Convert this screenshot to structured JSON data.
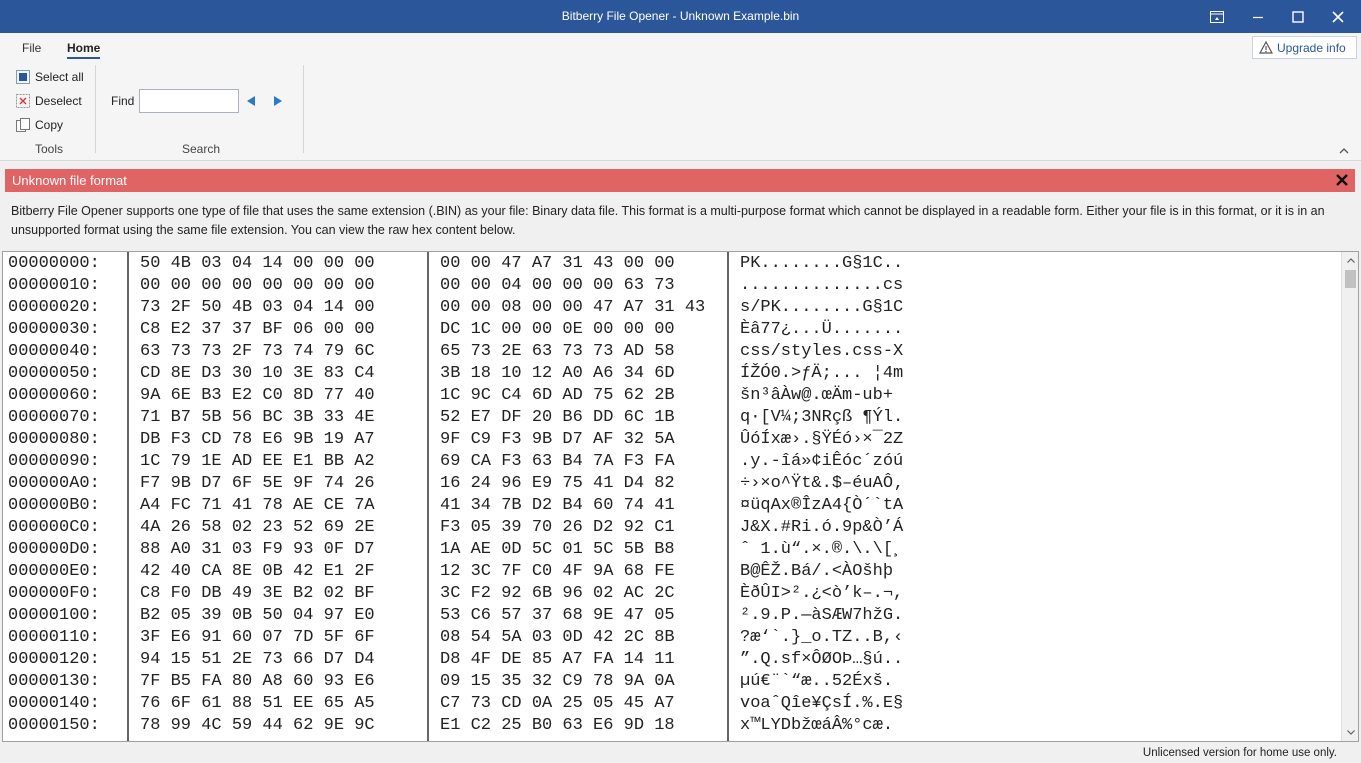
{
  "window": {
    "title": "Bitberry File Opener - Unknown Example.bin",
    "accent": "#2b579a"
  },
  "ribbon": {
    "tabs": [
      "File",
      "Home"
    ],
    "active_tab": "Home",
    "upgrade_label": "Upgrade info",
    "tools": {
      "select_all": "Select all",
      "deselect": "Deselect",
      "copy": "Copy",
      "group_label": "Tools"
    },
    "search": {
      "find_label": "Find",
      "find_value": "",
      "group_label": "Search"
    }
  },
  "alert": {
    "title": "Unknown file format",
    "color": "#e06464",
    "message": "Bitberry File Opener supports one type of file that uses the same extension (.BIN) as your file: Binary data file. This format is a multi-purpose format which cannot be displayed in a readable form. Either your file is in this format, or it is in an unsupported format using the same file extension. You can view the raw hex content below."
  },
  "hex": {
    "rows": [
      {
        "addr": "00000000:",
        "h1": "50 4B 03 04 14 00 00 00",
        "h2": "00 00 47 A7 31 43 00 00",
        "ascii": "PK........G§1C.."
      },
      {
        "addr": "00000010:",
        "h1": "00 00 00 00 00 00 00 00",
        "h2": "00 00 04 00 00 00 63 73",
        "ascii": "..............cs"
      },
      {
        "addr": "00000020:",
        "h1": "73 2F 50 4B 03 04 14 00",
        "h2": "00 00 08 00 00 47 A7 31 43",
        "ascii": "s/PK........G§1C"
      },
      {
        "addr": "00000030:",
        "h1": "C8 E2 37 37 BF 06 00 00",
        "h2": "DC 1C 00 00 0E 00 00 00",
        "ascii": "Èâ77¿...Ü......."
      },
      {
        "addr": "00000040:",
        "h1": "63 73 73 2F 73 74 79 6C",
        "h2": "65 73 2E 63 73 73 AD 58",
        "ascii": "css/styles.css-X"
      },
      {
        "addr": "00000050:",
        "h1": "CD 8E D3 30 10 3E 83 C4",
        "h2": "3B 18 10 12 A0 A6 34 6D",
        "ascii": "ÍŽÓ0.>ƒÄ;... ¦4m"
      },
      {
        "addr": "00000060:",
        "h1": "9A 6E B3 E2 C0 8D 77 40",
        "h2": "1C 9C C4 6D AD 75 62 2B",
        "ascii": "šn³âÀw@.œÄm-ub+"
      },
      {
        "addr": "00000070:",
        "h1": "71 B7 5B 56 BC 3B 33 4E",
        "h2": "52 E7 DF 20 B6 DD 6C 1B",
        "ascii": "q·[V¼;3NRçß ¶Ýl."
      },
      {
        "addr": "00000080:",
        "h1": "DB F3 CD 78 E6 9B 19 A7",
        "h2": "9F C9 F3 9B D7 AF 32 5A",
        "ascii": "ÛóÍxæ›.§ŸÉó›×¯2Z"
      },
      {
        "addr": "00000090:",
        "h1": "1C 79 1E AD EE E1 BB A2",
        "h2": "69 CA F3 63 B4 7A F3 FA",
        "ascii": ".y.-îá»¢iÊóc´zóú"
      },
      {
        "addr": "000000A0:",
        "h1": "F7 9B D7 6F 5E 9F 74 26",
        "h2": "16 24 96 E9 75 41 D4 82",
        "ascii": "÷›×o^Ÿt&.$–éuAÔ‚"
      },
      {
        "addr": "000000B0:",
        "h1": "A4 FC 71 41 78 AE CE 7A",
        "h2": "41 34 7B D2 B4 60 74 41",
        "ascii": "¤üqAx®ÎzA4{Ò´`tA"
      },
      {
        "addr": "000000C0:",
        "h1": "4A 26 58 02 23 52 69 2E",
        "h2": "F3 05 39 70 26 D2 92 C1",
        "ascii": "J&X.#Ri.ó.9p&Ò’Á"
      },
      {
        "addr": "000000D0:",
        "h1": "88 A0 31 03 F9 93 0F D7",
        "h2": "1A AE 0D 5C 01 5C 5B B8",
        "ascii": "ˆ 1.ù“.×.®.\\.\\[¸"
      },
      {
        "addr": "000000E0:",
        "h1": "42 40 CA 8E 0B 42 E1 2F",
        "h2": "12 3C 7F C0 4F 9A 68 FE",
        "ascii": "B@ÊŽ.Bá/.<ÀOšhþ"
      },
      {
        "addr": "000000F0:",
        "h1": "C8 F0 DB 49 3E B2 02 BF",
        "h2": "3C F2 92 6B 96 02 AC 2C",
        "ascii": "ÈðÛI>².¿<ò’k–.¬,"
      },
      {
        "addr": "00000100:",
        "h1": "B2 05 39 0B 50 04 97 E0",
        "h2": "53 C6 57 37 68 9E 47 05",
        "ascii": "².9.P.—àSÆW7hžG."
      },
      {
        "addr": "00000110:",
        "h1": "3F E6 91 60 07 7D 5F 6F",
        "h2": "08 54 5A 03 0D 42 2C 8B",
        "ascii": "?æ‘`.}_o.TZ..B,‹"
      },
      {
        "addr": "00000120:",
        "h1": "94 15 51 2E 73 66 D7 D4",
        "h2": "D8 4F DE 85 A7 FA 14 11",
        "ascii": "”.Q.sf×ÔØOÞ…§ú.."
      },
      {
        "addr": "00000130:",
        "h1": "7F B5 FA 80 A8 60 93 E6",
        "h2": "09 15 35 32 C9 78 9A 0A",
        "ascii": "µú€¨`“æ..52Éxš."
      },
      {
        "addr": "00000140:",
        "h1": "76 6F 61 88 51 EE 65 A5",
        "h2": "C7 73 CD 0A 25 05 45 A7",
        "ascii": "voaˆQîe¥ÇsÍ.%.E§"
      },
      {
        "addr": "00000150:",
        "h1": "78 99 4C 59 44 62 9E 9C",
        "h2": "E1 C2 25 B0 63 E6 9D 18",
        "ascii": "x™LYDbžœáÂ%°cæ."
      }
    ]
  },
  "status": {
    "text": "Unlicensed version for home use only."
  }
}
